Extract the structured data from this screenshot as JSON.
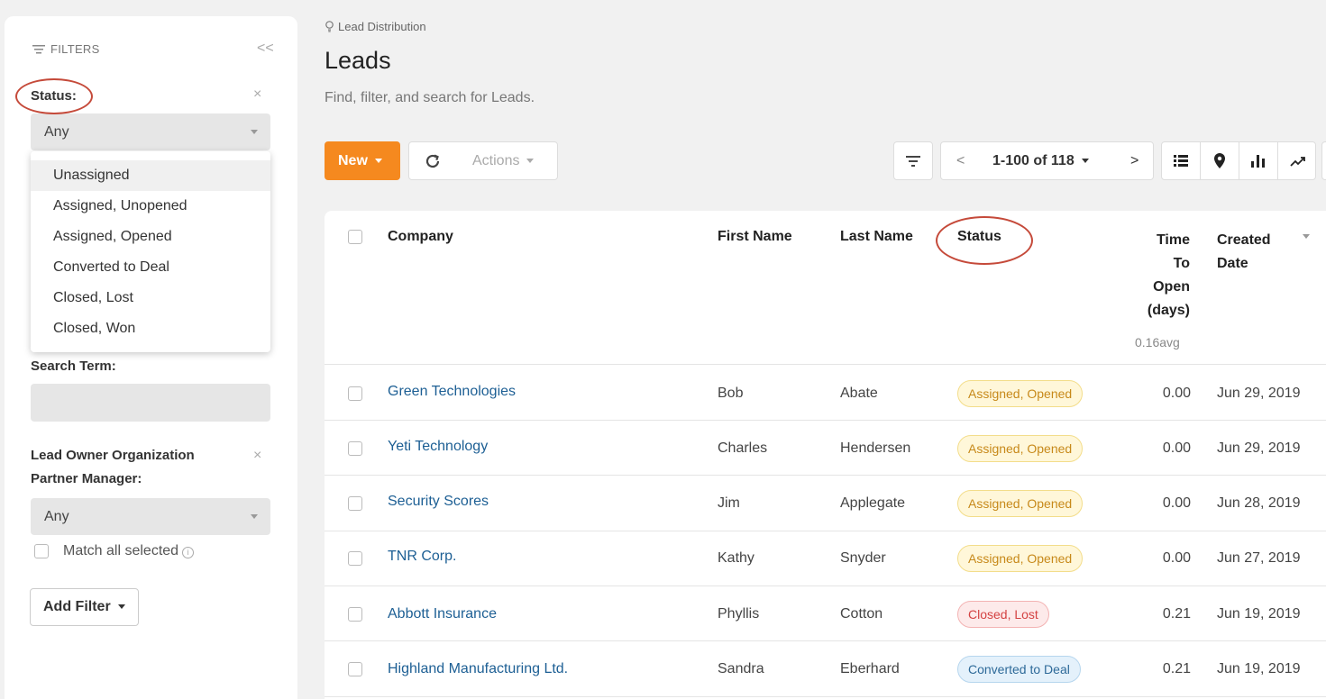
{
  "sidebar": {
    "filters_title": "FILTERS",
    "collapse_glyph": "<<",
    "status_label": "Status:",
    "status_value": "Any",
    "status_options": [
      "Unassigned",
      "Assigned, Unopened",
      "Assigned, Opened",
      "Converted to Deal",
      "Closed, Lost",
      "Closed, Won"
    ],
    "search_term_label": "Search Term:",
    "partner_manager_label_line1": "Lead Owner Organization",
    "partner_manager_label_line2": "Partner Manager:",
    "partner_manager_value": "Any",
    "match_all_label": "Match all selected",
    "add_filter_label": "Add Filter",
    "clear_glyph": "×"
  },
  "header": {
    "breadcrumb": "Lead Distribution",
    "title": "Leads",
    "subtitle": "Find, filter, and search for Leads."
  },
  "toolbar": {
    "new_label": "New",
    "actions_label": "Actions",
    "pager_text": "1-100 of 118",
    "prev_glyph": "<",
    "next_glyph": ">"
  },
  "table": {
    "headers": {
      "company": "Company",
      "first_name": "First Name",
      "last_name": "Last Name",
      "status": "Status",
      "time_to_open_1": "Time",
      "time_to_open_2": "To",
      "time_to_open_3": "Open",
      "time_to_open_4": "(days)",
      "time_to_open_avg": "0.16avg",
      "created_date_1": "Created",
      "created_date_2": "Date"
    },
    "rows": [
      {
        "company": "Green Technologies",
        "first": "Bob",
        "last": "Abate",
        "status": "Assigned, Opened",
        "time": "0.00",
        "date": "Jun 29, 2019"
      },
      {
        "company": "Yeti Technology",
        "first": "Charles",
        "last": "Hendersen",
        "status": "Assigned, Opened",
        "time": "0.00",
        "date": "Jun 29, 2019"
      },
      {
        "company": "Security Scores",
        "first": "Jim",
        "last": "Applegate",
        "status": "Assigned, Opened",
        "time": "0.00",
        "date": "Jun 28, 2019"
      },
      {
        "company": "TNR Corp.",
        "first": "Kathy",
        "last": "Snyder",
        "status": "Assigned, Opened",
        "time": "0.00",
        "date": "Jun 27, 2019"
      },
      {
        "company": "Abbott Insurance",
        "first": "Phyllis",
        "last": "Cotton",
        "status": "Closed, Lost",
        "time": "0.21",
        "date": "Jun 19, 2019"
      },
      {
        "company": "Highland Manufacturing Ltd.",
        "first": "Sandra",
        "last": "Eberhard",
        "status": "Converted to Deal",
        "time": "0.21",
        "date": "Jun 19, 2019"
      }
    ]
  },
  "colors": {
    "accent": "#f5891f",
    "link": "#1d5f94",
    "annotation": "#c54a3a"
  }
}
